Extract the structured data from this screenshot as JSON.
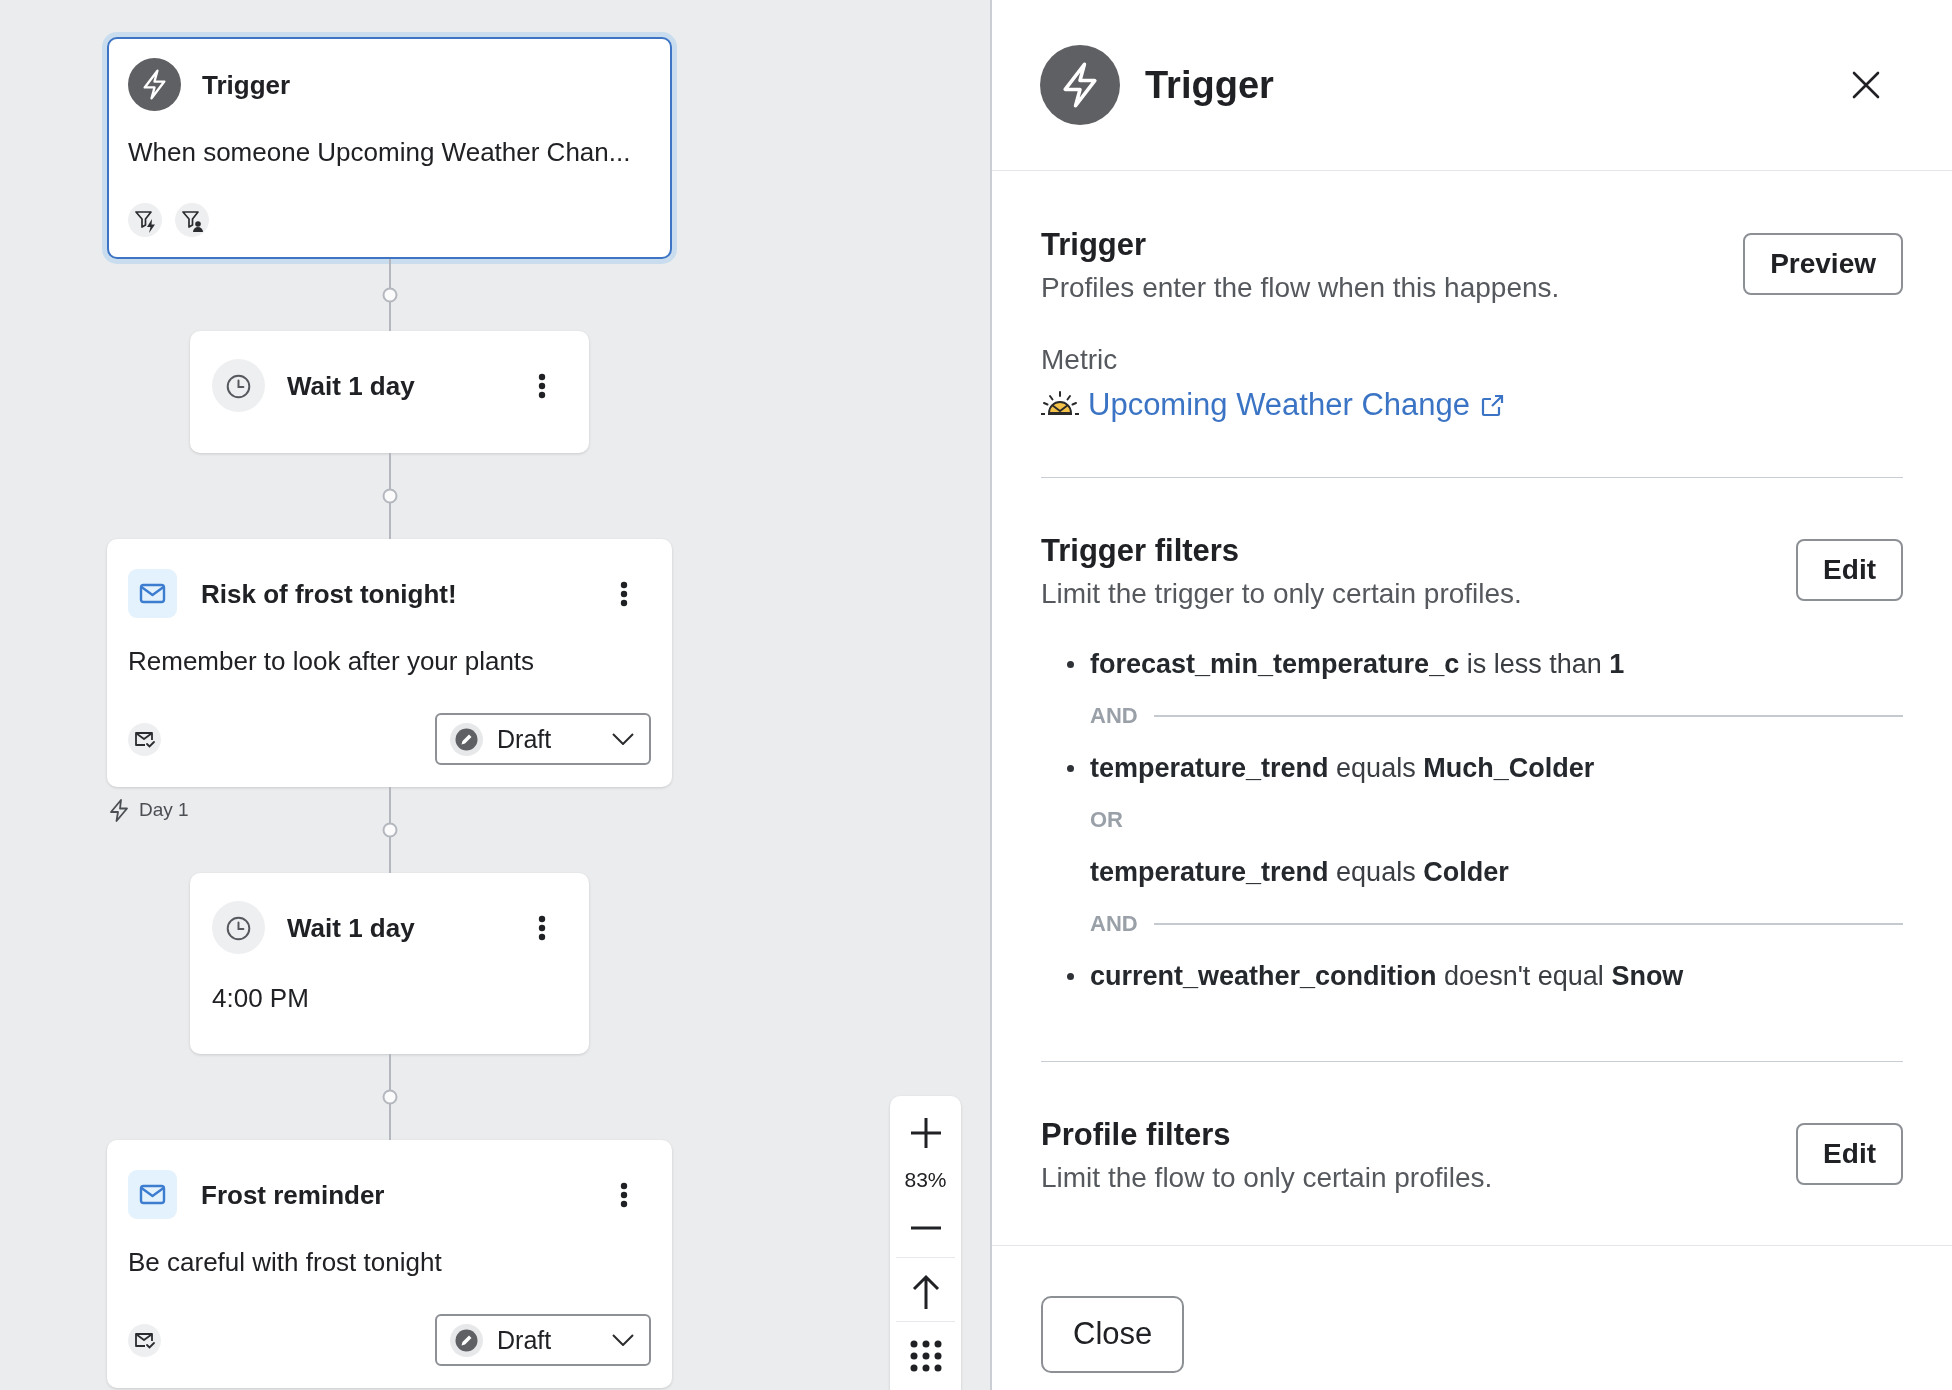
{
  "canvas": {
    "nodes": [
      {
        "kind": "trigger",
        "title": "Trigger",
        "text": "When someone Upcoming Weather Chan...",
        "selected": true
      },
      {
        "kind": "wait",
        "title": "Wait 1 day",
        "selected": false
      },
      {
        "kind": "email",
        "title": "Risk of frost tonight!",
        "text": "Remember to look after your plants",
        "status": "Draft",
        "selected": false,
        "day_marker": "Day 1"
      },
      {
        "kind": "wait",
        "title": "Wait 1 day",
        "text": "4:00 PM",
        "selected": false
      },
      {
        "kind": "email",
        "title": "Frost reminder",
        "text": "Be careful with frost tonight",
        "status": "Draft",
        "selected": false
      }
    ],
    "zoom_controls": {
      "zoom_level": "83%"
    }
  },
  "panel": {
    "title": "Trigger",
    "sections": [
      {
        "kind": "trigger",
        "title": "Trigger",
        "description": "Profiles enter the flow when this happens.",
        "button": "Preview",
        "metric_label": "Metric",
        "metric_name": "Upcoming Weather Change"
      },
      {
        "kind": "filters",
        "title": "Trigger filters",
        "description": "Limit the trigger to only certain profiles.",
        "button": "Edit",
        "conditions": [
          {
            "kind": "condition",
            "text": "**forecast_min_temperature_c** is less than **1**"
          },
          {
            "kind": "and",
            "text": "AND"
          },
          {
            "kind": "condition",
            "text": "**temperature_trend** equals **Much_Colder**"
          },
          {
            "kind": "or",
            "text": "OR"
          },
          {
            "kind": "alternative",
            "text": "**temperature_trend** equals **Colder**"
          },
          {
            "kind": "and",
            "text": "AND"
          },
          {
            "kind": "condition",
            "text": "**current_weather_condition** doesn't equal **Snow**"
          }
        ]
      },
      {
        "kind": "filters",
        "title": "Profile filters",
        "description": "Limit the flow to only certain profiles.",
        "button": "Edit"
      }
    ],
    "footer_button": "Close"
  }
}
